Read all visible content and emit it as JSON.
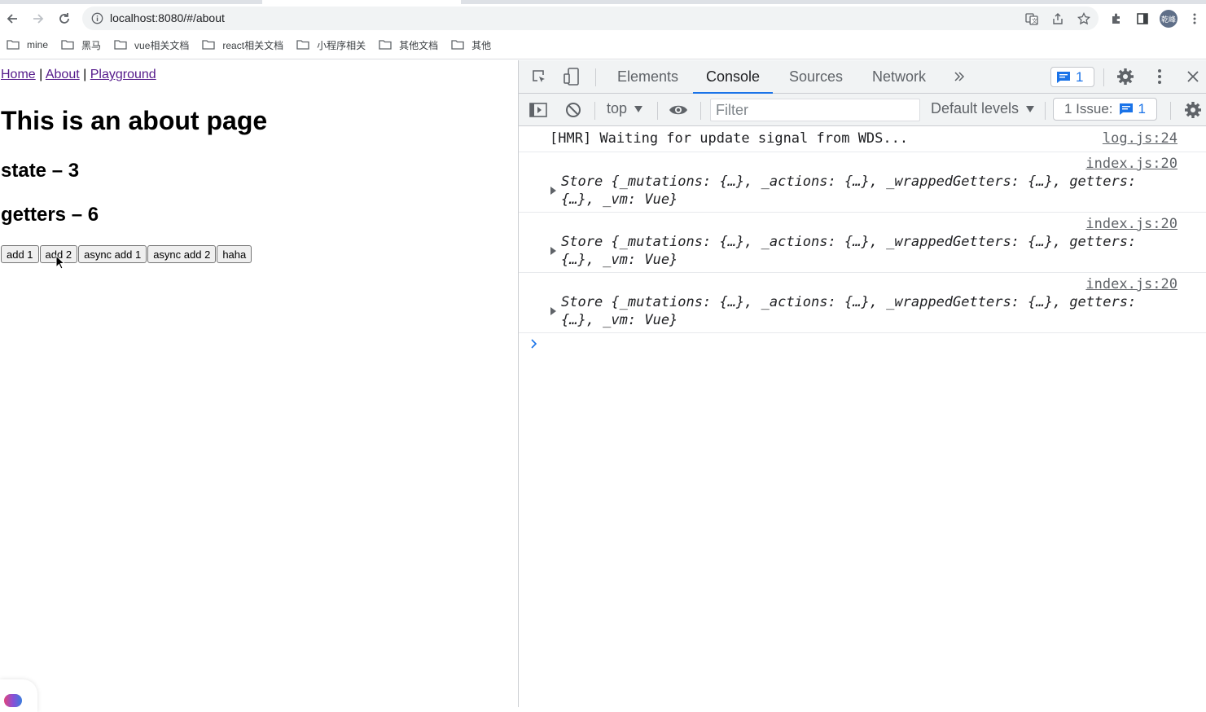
{
  "browser": {
    "url": "localhost:8080/#/about",
    "profile_initials": "乾峰",
    "bookmarks": [
      "mine",
      "黑马",
      "vue相关文档",
      "react相关文档",
      "小程序相关",
      "其他文档",
      "其他"
    ]
  },
  "page": {
    "nav": {
      "links": [
        "Home",
        "About",
        "Playground"
      ],
      "separator": "|"
    },
    "title": "This is an about page",
    "state_line": "state – 3",
    "getters_line": "getters – 6",
    "buttons": [
      "add 1",
      "add 2",
      "async add 1",
      "async add 2",
      "haha"
    ]
  },
  "devtools": {
    "tabs": [
      "Elements",
      "Console",
      "Sources",
      "Network"
    ],
    "active_tab": "Console",
    "message_badge_count": "1",
    "context": "top",
    "filter_placeholder": "Filter",
    "levels_label": "Default levels",
    "issues_label": "1 Issue:",
    "issues_count": "1",
    "console_rows": [
      {
        "kind": "plain",
        "message": "[HMR] Waiting for update signal from WDS...",
        "source": "log.js:24"
      },
      {
        "kind": "object",
        "source": "index.js:20",
        "line1": "Store {_mutations: {…}, _actions: {…}, _wrappedGetters: {…}, getters:",
        "line2": "{…}, _vm: Vue}"
      },
      {
        "kind": "object",
        "source": "index.js:20",
        "line1": "Store {_mutations: {…}, _actions: {…}, _wrappedGetters: {…}, getters:",
        "line2": "{…}, _vm: Vue}"
      },
      {
        "kind": "object",
        "source": "index.js:20",
        "line1": "Store {_mutations: {…}, _actions: {…}, _wrappedGetters: {…}, getters:",
        "line2": "{…}, _vm: Vue}"
      }
    ]
  },
  "colors": {
    "accent": "#1a73e8",
    "link_visited": "#551a8b",
    "toolbar_bg": "#f1f3f4"
  }
}
